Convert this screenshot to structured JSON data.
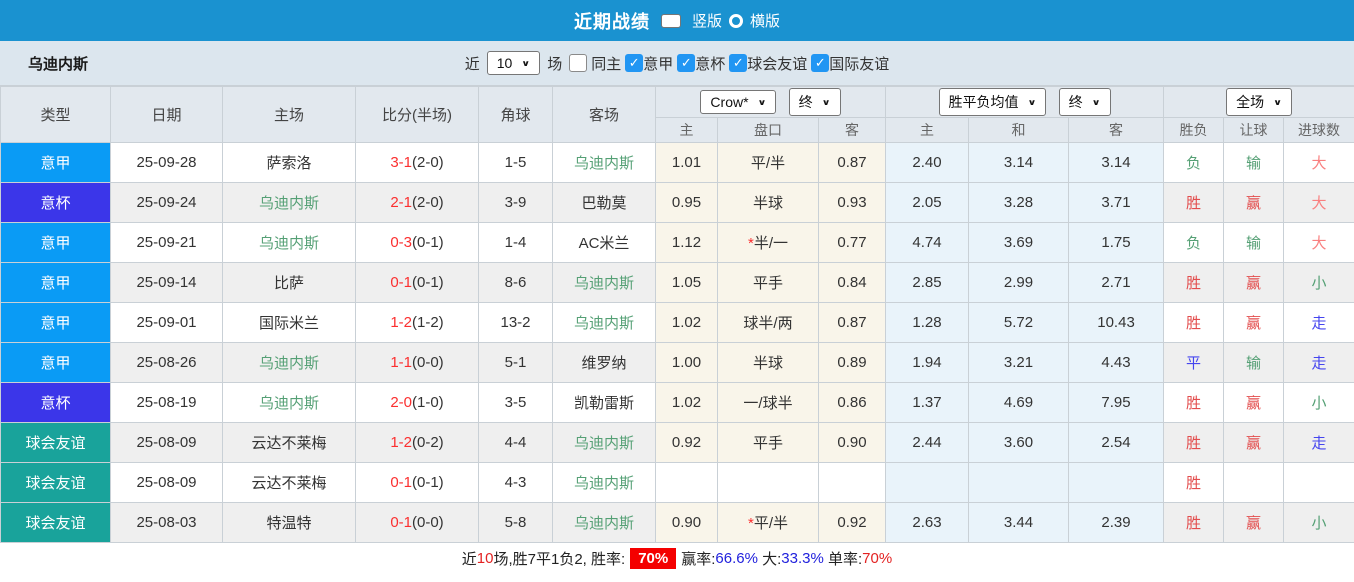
{
  "title_bar": {
    "title": "近期战绩",
    "radio_vertical": "竖版",
    "radio_horizontal": "横版"
  },
  "filter_bar": {
    "team_name": "乌迪内斯",
    "near_label": "近",
    "matches_count": "10",
    "games_label": "场",
    "checkboxes": [
      {
        "label": "同主",
        "checked": false
      },
      {
        "label": "意甲",
        "checked": true
      },
      {
        "label": "意杯",
        "checked": true
      },
      {
        "label": "球会友谊",
        "checked": true
      },
      {
        "label": "国际友谊",
        "checked": true
      }
    ]
  },
  "colors": {
    "topbar": "#1a92d0",
    "checkbox": "#2196f3",
    "seriea": "#0a9bf5",
    "cup": "#3b36e9",
    "friendly": "#19a39b",
    "win_red": "#e34d4d",
    "lose_green": "#55a075",
    "draw_blue": "#4545ef"
  },
  "table": {
    "col_headers": [
      "类型",
      "日期",
      "主场",
      "比分(半场)",
      "角球",
      "客场"
    ],
    "selects": {
      "company": "Crow*",
      "company_time": "终",
      "avg": "胜平负均值",
      "avg_time": "终",
      "scope": "全场"
    },
    "sub_headers": [
      "主",
      "盘口",
      "客",
      "主",
      "和",
      "客",
      "胜负",
      "让球",
      "进球数"
    ],
    "rows": [
      {
        "league": "意甲",
        "lc": "seriea",
        "date": "25-09-28",
        "home": "萨索洛",
        "hf": false,
        "score": "3-1",
        "half": "(2-0)",
        "corners": "1-5",
        "away": "乌迪内斯",
        "af": true,
        "odds": [
          "1.01",
          "平/半",
          "0.87"
        ],
        "star": false,
        "avg": [
          "2.40",
          "3.14",
          "3.14"
        ],
        "res": {
          "t": "负",
          "c": "lose"
        },
        "let": {
          "t": "输",
          "c": "lose"
        },
        "goal": {
          "t": "大",
          "c": "big"
        }
      },
      {
        "league": "意杯",
        "lc": "cup",
        "date": "25-09-24",
        "home": "乌迪内斯",
        "hf": true,
        "score": "2-1",
        "half": "(2-0)",
        "corners": "3-9",
        "away": "巴勒莫",
        "af": false,
        "odds": [
          "0.95",
          "半球",
          "0.93"
        ],
        "star": false,
        "avg": [
          "2.05",
          "3.28",
          "3.71"
        ],
        "res": {
          "t": "胜",
          "c": "win"
        },
        "let": {
          "t": "赢",
          "c": "win"
        },
        "goal": {
          "t": "大",
          "c": "big"
        }
      },
      {
        "league": "意甲",
        "lc": "seriea",
        "date": "25-09-21",
        "home": "乌迪内斯",
        "hf": true,
        "score": "0-3",
        "half": "(0-1)",
        "corners": "1-4",
        "away": "AC米兰",
        "af": false,
        "odds": [
          "1.12",
          "半/一",
          "0.77"
        ],
        "star": true,
        "avg": [
          "4.74",
          "3.69",
          "1.75"
        ],
        "res": {
          "t": "负",
          "c": "lose"
        },
        "let": {
          "t": "输",
          "c": "lose"
        },
        "goal": {
          "t": "大",
          "c": "big"
        }
      },
      {
        "league": "意甲",
        "lc": "seriea",
        "date": "25-09-14",
        "home": "比萨",
        "hf": false,
        "score": "0-1",
        "half": "(0-1)",
        "corners": "8-6",
        "away": "乌迪内斯",
        "af": true,
        "odds": [
          "1.05",
          "平手",
          "0.84"
        ],
        "star": false,
        "avg": [
          "2.85",
          "2.99",
          "2.71"
        ],
        "res": {
          "t": "胜",
          "c": "win"
        },
        "let": {
          "t": "赢",
          "c": "win"
        },
        "goal": {
          "t": "小",
          "c": "small"
        }
      },
      {
        "league": "意甲",
        "lc": "seriea",
        "date": "25-09-01",
        "home": "国际米兰",
        "hf": false,
        "score": "1-2",
        "half": "(1-2)",
        "corners": "13-2",
        "away": "乌迪内斯",
        "af": true,
        "odds": [
          "1.02",
          "球半/两",
          "0.87"
        ],
        "star": false,
        "avg": [
          "1.28",
          "5.72",
          "10.43"
        ],
        "res": {
          "t": "胜",
          "c": "win"
        },
        "let": {
          "t": "赢",
          "c": "win"
        },
        "goal": {
          "t": "走",
          "c": "go"
        }
      },
      {
        "league": "意甲",
        "lc": "seriea",
        "date": "25-08-26",
        "home": "乌迪内斯",
        "hf": true,
        "score": "1-1",
        "half": "(0-0)",
        "corners": "5-1",
        "away": "维罗纳",
        "af": false,
        "odds": [
          "1.00",
          "半球",
          "0.89"
        ],
        "star": false,
        "avg": [
          "1.94",
          "3.21",
          "4.43"
        ],
        "res": {
          "t": "平",
          "c": "draw"
        },
        "let": {
          "t": "输",
          "c": "lose"
        },
        "goal": {
          "t": "走",
          "c": "go"
        }
      },
      {
        "league": "意杯",
        "lc": "cup",
        "date": "25-08-19",
        "home": "乌迪内斯",
        "hf": true,
        "score": "2-0",
        "half": "(1-0)",
        "corners": "3-5",
        "away": "凯勒雷斯",
        "af": false,
        "odds": [
          "1.02",
          "一/球半",
          "0.86"
        ],
        "star": false,
        "avg": [
          "1.37",
          "4.69",
          "7.95"
        ],
        "res": {
          "t": "胜",
          "c": "win"
        },
        "let": {
          "t": "赢",
          "c": "win"
        },
        "goal": {
          "t": "小",
          "c": "small"
        }
      },
      {
        "league": "球会友谊",
        "lc": "friendly",
        "date": "25-08-09",
        "home": "云达不莱梅",
        "hf": false,
        "score": "1-2",
        "half": "(0-2)",
        "corners": "4-4",
        "away": "乌迪内斯",
        "af": true,
        "odds": [
          "0.92",
          "平手",
          "0.90"
        ],
        "star": false,
        "avg": [
          "2.44",
          "3.60",
          "2.54"
        ],
        "res": {
          "t": "胜",
          "c": "win"
        },
        "let": {
          "t": "赢",
          "c": "win"
        },
        "goal": {
          "t": "走",
          "c": "go"
        }
      },
      {
        "league": "球会友谊",
        "lc": "friendly",
        "date": "25-08-09",
        "home": "云达不莱梅",
        "hf": false,
        "score": "0-1",
        "half": "(0-1)",
        "corners": "4-3",
        "away": "乌迪内斯",
        "af": true,
        "odds": [
          "",
          "",
          ""
        ],
        "star": false,
        "avg": [
          "",
          "",
          ""
        ],
        "res": {
          "t": "胜",
          "c": "win"
        },
        "let": {
          "t": "",
          "c": ""
        },
        "goal": {
          "t": "",
          "c": ""
        }
      },
      {
        "league": "球会友谊",
        "lc": "friendly",
        "date": "25-08-03",
        "home": "特温特",
        "hf": false,
        "score": "0-1",
        "half": "(0-0)",
        "corners": "5-8",
        "away": "乌迪内斯",
        "af": true,
        "odds": [
          "0.90",
          "平/半",
          "0.92"
        ],
        "star": true,
        "avg": [
          "2.63",
          "3.44",
          "2.39"
        ],
        "res": {
          "t": "胜",
          "c": "win"
        },
        "let": {
          "t": "赢",
          "c": "win"
        },
        "goal": {
          "t": "小",
          "c": "small"
        }
      }
    ]
  },
  "footer": {
    "segments": [
      {
        "t": "近",
        "c": "dark"
      },
      {
        "t": "10",
        "c": "red"
      },
      {
        "t": "场,胜7平1负2, 胜率:",
        "c": "dark"
      },
      {
        "t": "70%",
        "c": "badge"
      },
      {
        "t": "赢率:",
        "c": "dark"
      },
      {
        "t": "66.6%",
        "c": "blue"
      },
      {
        "t": " 大:",
        "c": "dark"
      },
      {
        "t": "33.3%",
        "c": "blue"
      },
      {
        "t": " 单率:",
        "c": "dark"
      },
      {
        "t": "70%",
        "c": "red"
      }
    ]
  }
}
